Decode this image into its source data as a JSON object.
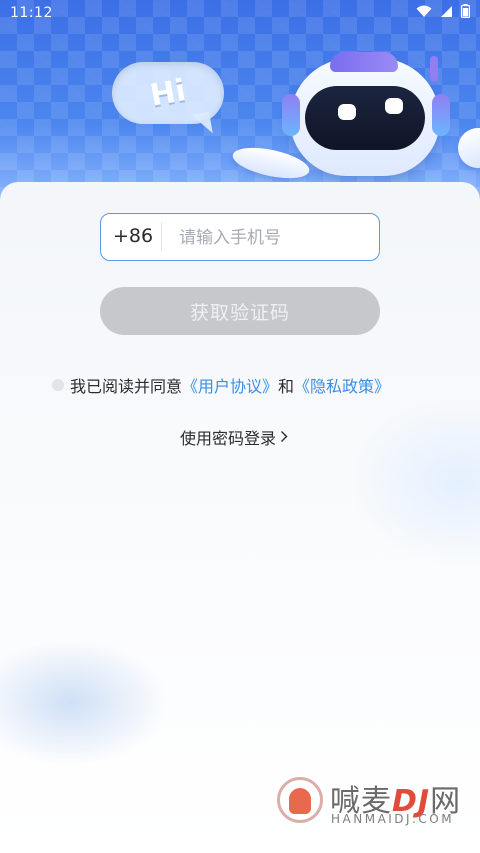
{
  "status_bar": {
    "time": "11:12"
  },
  "hero": {
    "bubble_text": "Hi"
  },
  "login": {
    "country_code": "+86",
    "phone_placeholder": "请输入手机号",
    "get_code_label": "获取验证码",
    "agree_prefix": "我已阅读并同意",
    "user_agreement": "《用户协议》",
    "and_text": "和",
    "privacy_policy": "《隐私政策》",
    "password_login": "使用密码登录"
  },
  "watermark": {
    "title_left": "喊麦",
    "title_highlight": "DJ",
    "title_right": "网",
    "subtitle": "HANMAIDJ.COM"
  },
  "colors": {
    "hero_blue": "#3f74e8",
    "accent_link": "#3a8ee6",
    "input_border": "#5a9bdc",
    "button_disabled": "#c7c8cc"
  },
  "icons": [
    "wifi-icon",
    "signal-icon",
    "battery-icon",
    "chevron-right-icon",
    "robot-mascot",
    "speech-bubble"
  ]
}
